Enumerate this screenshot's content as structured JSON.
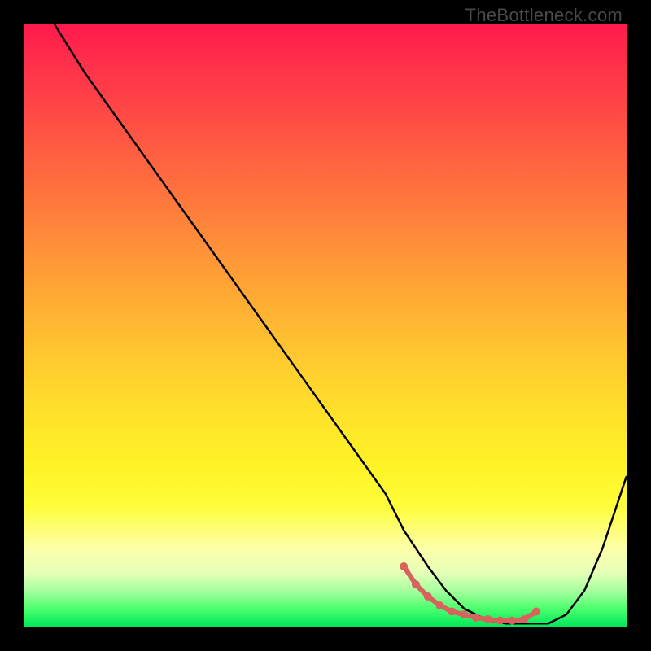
{
  "watermark": "TheBottleneck.com",
  "chart_data": {
    "type": "line",
    "title": "",
    "xlabel": "",
    "ylabel": "",
    "xlim": [
      0,
      100
    ],
    "ylim": [
      0,
      100
    ],
    "series": [
      {
        "name": "curve",
        "x": [
          5,
          10,
          15,
          20,
          25,
          30,
          35,
          40,
          45,
          50,
          55,
          60,
          63,
          67,
          70,
          73,
          77,
          80,
          83,
          87,
          90,
          93,
          96,
          100
        ],
        "values": [
          100,
          92,
          85,
          78,
          71,
          64,
          57,
          50,
          43,
          36,
          29,
          22,
          16,
          10,
          6,
          3,
          1,
          0.5,
          0.5,
          0.5,
          2,
          6,
          13,
          25
        ]
      }
    ],
    "markers": {
      "name": "highlight",
      "x": [
        63,
        65,
        67,
        69,
        71,
        73,
        75,
        77,
        79,
        81,
        83,
        85
      ],
      "values": [
        10,
        7,
        5,
        3.5,
        2.5,
        2,
        1.5,
        1.2,
        1,
        1,
        1.2,
        2.5
      ]
    },
    "colors": {
      "curve": "#000000",
      "markers": "#d8635e",
      "gradient_top": "#ff1a4c",
      "gradient_mid": "#ffe22a",
      "gradient_bot": "#00e85a"
    }
  }
}
